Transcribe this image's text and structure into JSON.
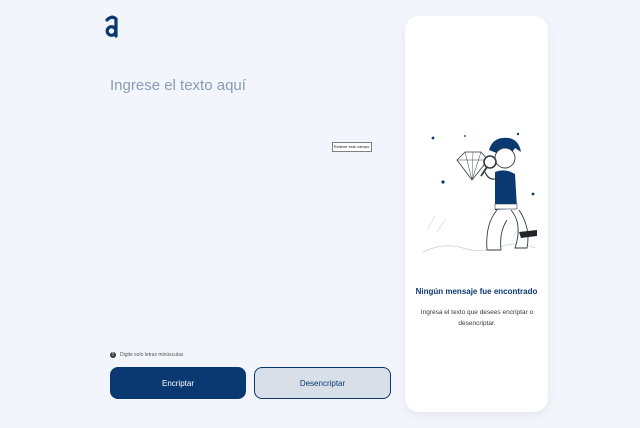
{
  "logo": {
    "icon": "alura-logo-icon",
    "color": "#0a3871"
  },
  "input": {
    "placeholder": "Ingrese el texto aquí"
  },
  "validation": {
    "tooltip": "Rellene este campo."
  },
  "hint": {
    "icon": "info-icon",
    "text": "Digite solo letras minúsculas"
  },
  "buttons": {
    "encrypt": "Encriptar",
    "decrypt": "Desencriptar"
  },
  "output": {
    "title": "Ningún mensaje fue encontrado",
    "message": "Ingresa el texto que desees encriptar o desencriptar.",
    "illustration": "person-with-magnifier-illustration"
  },
  "colors": {
    "primary": "#0a3871",
    "background": "#f3f5fc",
    "card": "#ffffff",
    "secondary_button": "#d8dfe8"
  }
}
